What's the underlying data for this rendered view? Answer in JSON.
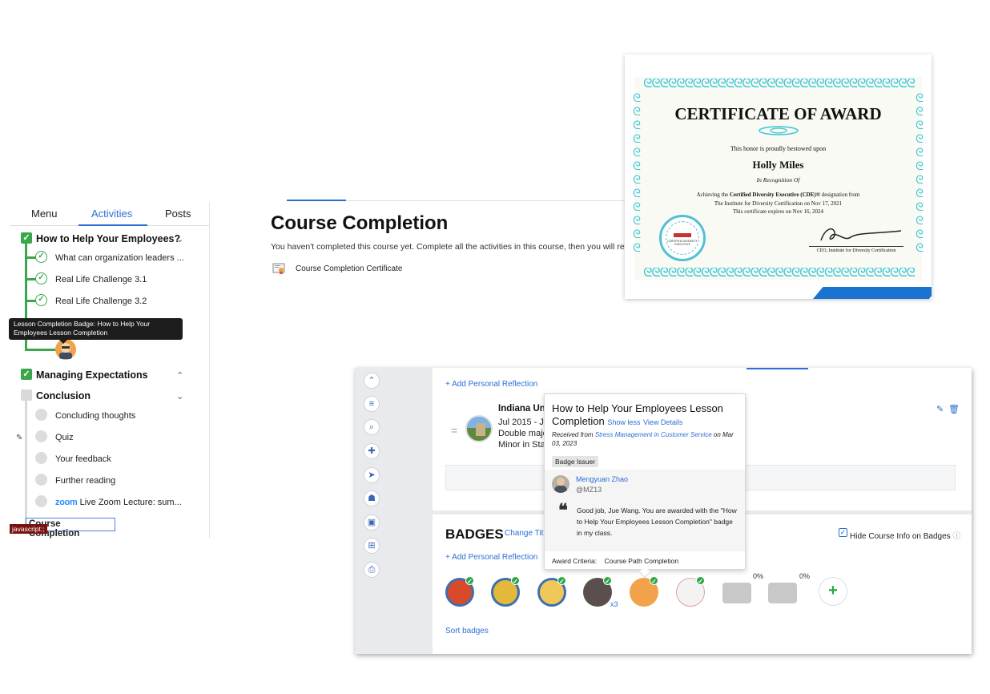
{
  "sidebar": {
    "tabs": [
      "Menu",
      "Activities",
      "Posts"
    ],
    "sections": [
      {
        "title": "How to Help Your Employees?",
        "items": [
          "What can organization leaders ...",
          "Real Life Challenge 3.1",
          "Real Life Challenge 3.2"
        ]
      },
      {
        "title": "Managing Expectations"
      },
      {
        "title": "Conclusion",
        "items": [
          "Concluding thoughts",
          "Quiz",
          "Your feedback",
          "Further reading",
          "Live Zoom Lecture: sum..."
        ],
        "zoom_word": "zoom"
      }
    ],
    "tooltip": "Lesson Completion Badge: How to Help Your Employees Lesson Completion",
    "focused_item": "Course Completion",
    "status_bar": "javascript:;"
  },
  "course_completion": {
    "title": "Course Completion",
    "description": "You haven't completed this course yet. Complete all the activities in this course, then you will receive:",
    "reward": "Course Completion Certificate"
  },
  "certificate": {
    "heading": "CERTIFICATE OF AWARD",
    "honor_line": "This honor is proudly bestowed upon",
    "recipient": "Holly Miles",
    "recognition": "In Recognition Of",
    "line1_prefix": "Achieving the",
    "line1_bold": "Certified Diversity Executive (CDE)®",
    "line1_suffix": "designation from",
    "line2": "The Institute for Diversity Certification on Nov 17, 2021",
    "line3": "This certificate expires on Nov 16, 2024",
    "signer": "CEO, Institute for Diversity Certification",
    "seal_text": "CERTIFIED DIVERSITY EXECUTIVE"
  },
  "profile": {
    "add_reflection": "+ Add Personal Reflection",
    "education": {
      "school": "Indiana Uni",
      "dates": "Jul 2015 - Ju",
      "line2": "Double major",
      "line3": "Minor in Stat"
    },
    "badges_title": "BADGES",
    "change_title": "Change Tit",
    "hide_course_info": "Hide Course Info on Badges",
    "badge_percents": [
      "0%",
      "0%"
    ],
    "badge_multiplier": "x3",
    "sort_badges": "Sort badges"
  },
  "popover": {
    "title": "How to Help Your Employees Lesson Completion",
    "show_less": "Show less",
    "view_details": "View Details",
    "received_prefix": "Received from",
    "received_source": "Stress Management in Customer Service",
    "received_date": "on Mar 03, 2023",
    "issuer_tag": "Badge Issuer",
    "issuer_name": "Mengyuan Zhao",
    "issuer_handle": "@MZ13",
    "quote": "Good job, Jue Wang. You are awarded with the \"How to Help Your Employees Lesson Completion\" badge in my class.",
    "criteria_label": "Award Criteria:",
    "criteria_value": "Course Path Completion"
  },
  "colors": {
    "accent": "#2b6fd6",
    "complete_green": "#3aa84a",
    "certificate_teal": "#38c6d6"
  }
}
